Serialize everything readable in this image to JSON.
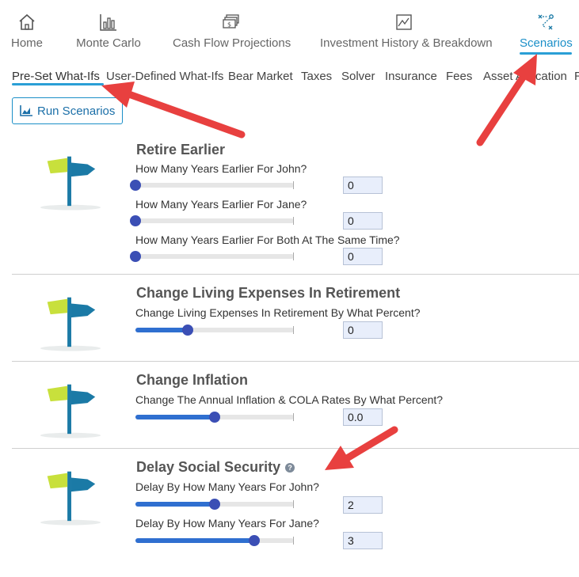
{
  "top_nav": [
    {
      "label": "Home",
      "icon": "home-icon"
    },
    {
      "label": "Monte Carlo",
      "icon": "bar-chart-icon"
    },
    {
      "label": "Cash Flow Projections",
      "icon": "cash-icon"
    },
    {
      "label": "Investment History & Breakdown",
      "icon": "line-chart-icon"
    },
    {
      "label": "Scenarios",
      "icon": "scenario-path-icon",
      "active": true
    }
  ],
  "sub_nav": [
    {
      "label": "Pre-Set What-Ifs",
      "active": true
    },
    {
      "label": "User-Defined What-Ifs"
    },
    {
      "label": "Bear Market"
    },
    {
      "label": "Taxes"
    },
    {
      "label": "Solver"
    },
    {
      "label": "Insurance"
    },
    {
      "label": "Fees"
    },
    {
      "label": "Asset Allocation"
    },
    {
      "label": "R"
    }
  ],
  "run_button": {
    "label": "Run Scenarios",
    "icon": "bar-chart-icon"
  },
  "sections": [
    {
      "title": "Retire Earlier",
      "fields": [
        {
          "label": "How Many Years Earlier For John?",
          "value": "0",
          "slider_fraction": 0.0
        },
        {
          "label": "How Many Years Earlier For Jane?",
          "value": "0",
          "slider_fraction": 0.0
        },
        {
          "label": "How Many Years Earlier For Both At The Same Time?",
          "value": "0",
          "slider_fraction": 0.0
        }
      ]
    },
    {
      "title": "Change Living Expenses In Retirement",
      "fields": [
        {
          "label": "Change Living Expenses In Retirement By What Percent?",
          "value": "0",
          "slider_fraction": 0.33
        }
      ]
    },
    {
      "title": "Change Inflation",
      "fields": [
        {
          "label": "Change The Annual Inflation & COLA Rates By What Percent?",
          "value": "0.0",
          "slider_fraction": 0.5
        }
      ]
    },
    {
      "title": "Delay Social Security",
      "help_icon": "?",
      "fields": [
        {
          "label": "Delay By How Many Years For John?",
          "value": "2",
          "slider_fraction": 0.5
        },
        {
          "label": "Delay By How Many Years For Jane?",
          "value": "3",
          "slider_fraction": 0.75
        }
      ]
    }
  ],
  "colors": {
    "accent": "#2a9fd6",
    "slider_fill": "#2f6fd0",
    "slider_thumb": "#3b4fb5",
    "value_box": "#e8eefb",
    "annotation_arrow": "#e8403f",
    "sign_green": "#c8e03c",
    "sign_blue": "#1b7aa6"
  }
}
